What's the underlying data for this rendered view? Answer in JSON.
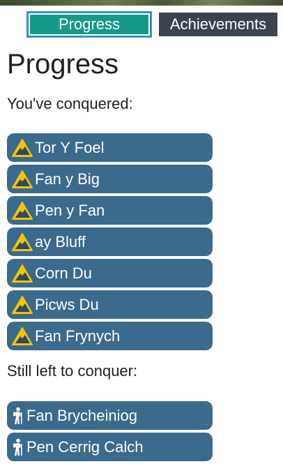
{
  "tabs": {
    "progress_label": "Progress",
    "achievements_label": "Achievements"
  },
  "page": {
    "title": "Progress",
    "conquered_label": "You've conquered:",
    "remaining_label": "Still left to conquer:"
  },
  "conquered": [
    {
      "name": "Tor Y Foel",
      "icon": "mountain-warning-icon"
    },
    {
      "name": "Fan y Big",
      "icon": "mountain-warning-icon"
    },
    {
      "name": "Pen y Fan",
      "icon": "mountain-warning-icon"
    },
    {
      "name": "ay Bluff",
      "icon": "mountain-warning-icon"
    },
    {
      "name": "Corn Du",
      "icon": "mountain-warning-icon"
    },
    {
      "name": "Picws Du",
      "icon": "mountain-warning-icon"
    },
    {
      "name": "Fan Frynych",
      "icon": "mountain-warning-icon"
    }
  ],
  "remaining": [
    {
      "name": "Fan Brycheiniog",
      "icon": "hiker-icon"
    },
    {
      "name": "Pen Cerrig Calch",
      "icon": "hiker-icon"
    }
  ],
  "colors": {
    "tab_active": "#17998a",
    "tab_inactive": "#3a4350",
    "peak_bg": "#3b6a8c",
    "icon_yellow": "#f5c400"
  }
}
